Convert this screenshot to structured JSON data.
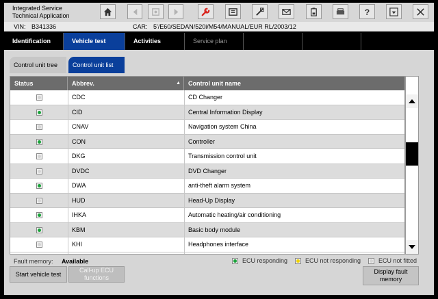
{
  "app": {
    "title_line1": "Integrated Service",
    "title_line2": "Technical Application"
  },
  "toolbar": {
    "icons": [
      "home-icon",
      "back-icon",
      "print-settings-icon",
      "forward-icon",
      "wrench-icon",
      "manual-icon",
      "connect-icon",
      "mail-icon",
      "battery-icon",
      "printer-icon",
      "help-icon",
      "dropdown-icon",
      "close-icon"
    ]
  },
  "vehicle": {
    "vin_label": "VIN:",
    "vin": "B341336",
    "car_label": "CAR:",
    "car": "5'/E60/SEDAN/520i/M54/MANUAL/EUR RL/2003/12"
  },
  "main_tabs": [
    {
      "label": "Identification"
    },
    {
      "label": "Vehicle test"
    },
    {
      "label": "Activities"
    },
    {
      "label": "Service plan"
    }
  ],
  "sub_tabs": [
    {
      "label": "Control unit tree"
    },
    {
      "label": "Control unit list"
    }
  ],
  "table": {
    "headers": {
      "status": "Status",
      "abbrev": "Abbrev.",
      "name": "Control unit name"
    },
    "rows": [
      {
        "status": "not-fitted",
        "abbrev": "CDC",
        "name": "CD Changer"
      },
      {
        "status": "responding",
        "abbrev": "CID",
        "name": "Central Information Display"
      },
      {
        "status": "not-fitted",
        "abbrev": "CNAV",
        "name": "Navigation system China"
      },
      {
        "status": "responding",
        "abbrev": "CON",
        "name": "Controller"
      },
      {
        "status": "not-fitted",
        "abbrev": "DKG",
        "name": "Transmission control unit"
      },
      {
        "status": "not-fitted",
        "abbrev": "DVDC",
        "name": "DVD Changer"
      },
      {
        "status": "responding",
        "abbrev": "DWA",
        "name": "anti-theft alarm system"
      },
      {
        "status": "not-fitted",
        "abbrev": "HUD",
        "name": "Head-Up Display"
      },
      {
        "status": "responding",
        "abbrev": "IHKA",
        "name": "Automatic heating/air conditioning"
      },
      {
        "status": "responding",
        "abbrev": "KBM",
        "name": "Basic body module"
      },
      {
        "status": "not-fitted",
        "abbrev": "KHI",
        "name": "Headphones interface"
      }
    ]
  },
  "footer": {
    "fault_label": "Fault memory:",
    "fault_value": "Available",
    "legend_responding": "ECU responding",
    "legend_not_responding": "ECU not responding",
    "legend_not_fitted": "ECU not fitted",
    "start_test": "Start vehicle test",
    "call_up_line1": "Call-up ECU",
    "call_up_line2": "functions",
    "display_fault_line1": "Display fault",
    "display_fault_line2": "memory"
  },
  "colors": {
    "accent": "#0a3f9b",
    "responding": "#1aa33a",
    "not_responding": "#f0d200"
  }
}
